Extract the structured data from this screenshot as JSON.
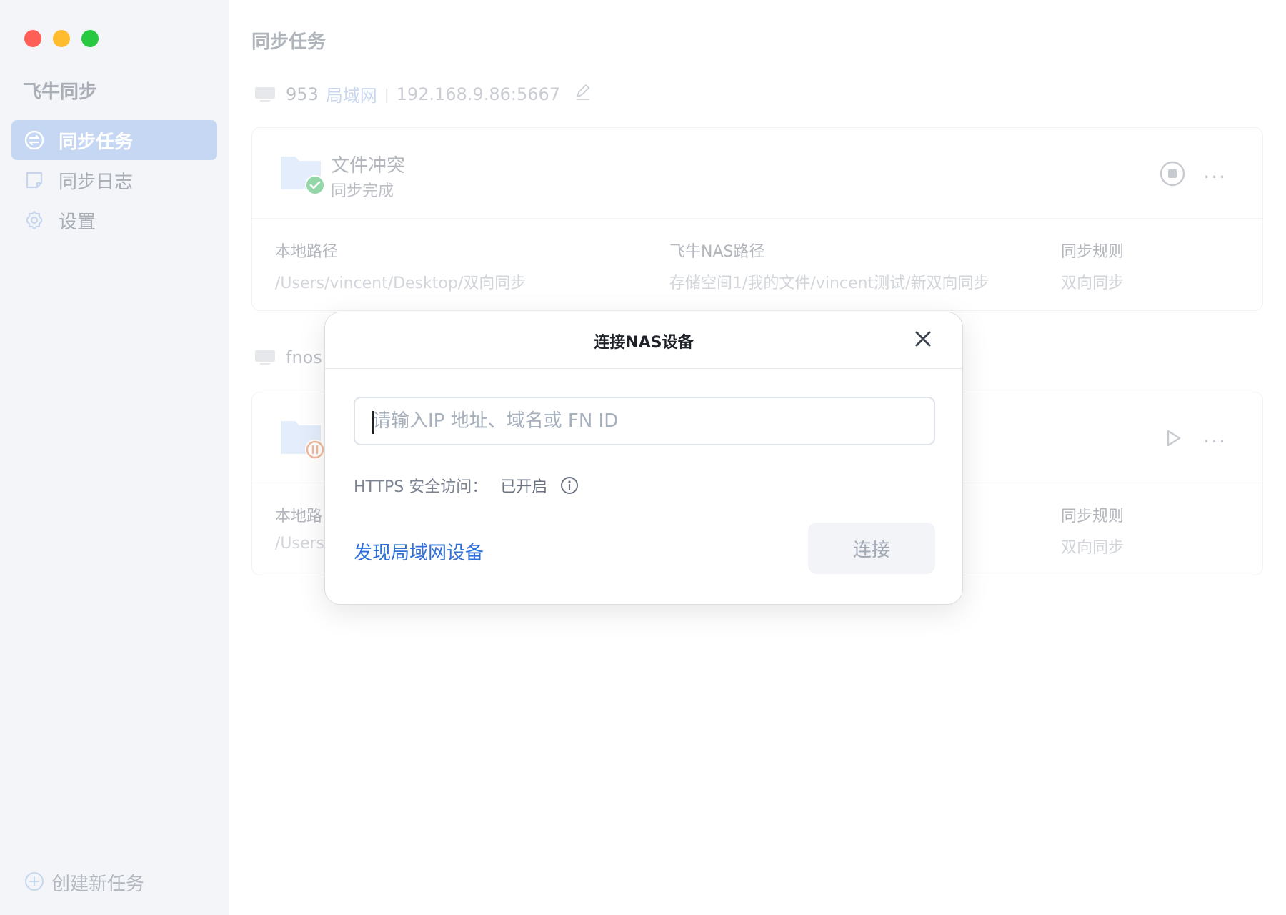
{
  "sidebar": {
    "app_title": "飞牛同步",
    "items": [
      {
        "label": "同步任务",
        "icon": "sync-icon",
        "active": true
      },
      {
        "label": "同步日志",
        "icon": "note-icon",
        "active": false
      },
      {
        "label": "设置",
        "icon": "gear-icon",
        "active": false
      }
    ],
    "create_task_label": "创建新任务"
  },
  "main": {
    "page_title": "同步任务",
    "devices": [
      {
        "name": "953",
        "network": "局域网",
        "address": "192.168.9.86:5667",
        "task": {
          "name": "文件冲突",
          "status": "同步完成",
          "local_label": "本地路径",
          "local_value": "/Users/vincent/Desktop/双向同步",
          "nas_label": "飞牛NAS路径",
          "nas_value": "存储空间1/我的文件/vincent测试/新双向同步",
          "rule_label": "同步规则",
          "rule_value": "双向同步",
          "more": "···"
        }
      },
      {
        "name": "fnos",
        "task": {
          "local_label": "本地路",
          "local_value": "/Users",
          "rule_label": "同步规则",
          "rule_value": "双向同步",
          "more": "···"
        }
      }
    ]
  },
  "dialog": {
    "title": "连接NAS设备",
    "input_placeholder": "请输入IP 地址、域名或 FN ID",
    "input_value": "",
    "https_label": "HTTPS 安全访问：",
    "https_state": "已开启",
    "discover_link": "发现局域网设备",
    "connect_button": "连接"
  },
  "colors": {
    "accent": "#2f6fd8",
    "active_nav": "#c6d7f3",
    "success": "#7fd29a",
    "paused": "#f0b89a"
  }
}
